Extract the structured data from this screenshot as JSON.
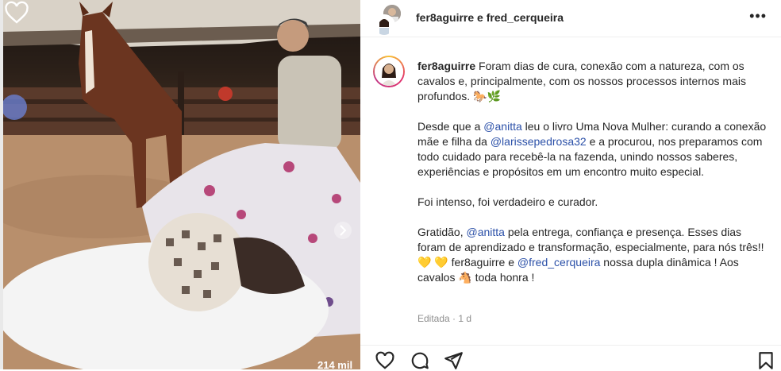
{
  "header": {
    "title": "fer8aguirre e fred_cerqueira",
    "more_icon": "more-horizontal-icon"
  },
  "media": {
    "likes_text": "214 mil",
    "like_icon": "heart-outline-icon"
  },
  "caption": {
    "author": "fer8aguirre",
    "p1_text": " Foram dias de cura, conexão com a natureza, com os cavalos e, principalmente, com os nossos processos internos mais profundos. 🐎🌿",
    "p2_a": "Desde que a ",
    "p2_mention1": "@anitta",
    "p2_b": " leu o livro Uma Nova Mulher: curando a conexão mãe e filha da ",
    "p2_mention2": "@larissepedrosa32",
    "p2_c": " e a procurou, nos preparamos com todo cuidado para recebê-la na fazenda, unindo nossos saberes, experiências e propósitos em um encontro muito especial.",
    "p3_text": "Foi intenso, foi verdadeiro e curador.",
    "p4_a": "Gratidão, ",
    "p4_mention1": "@anitta",
    "p4_b": " pela entrega, confiança e presença. Esses dias foram de aprendizado e transformação, especialmente, para nós três!! 💛 💛 fer8aguirre e ",
    "p4_mention2": "@fred_cerqueira",
    "p4_c": " nossa dupla dinâmica ! Aos cavalos 🐴 toda honra !"
  },
  "meta": {
    "edited": "Editada",
    "separator": " · ",
    "time": "1 d"
  },
  "actions": {
    "like_icon": "heart-icon",
    "comment_icon": "comment-icon",
    "share_icon": "share-icon",
    "save_icon": "bookmark-icon"
  }
}
